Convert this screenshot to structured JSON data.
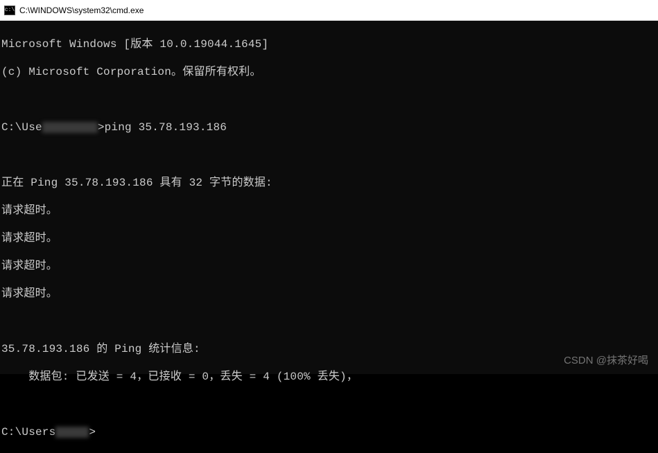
{
  "titlebar": {
    "path": "C:\\WINDOWS\\system32\\cmd.exe"
  },
  "terminal": {
    "banner_version": "Microsoft Windows [版本 10.0.19044.1645]",
    "banner_copyright": "(c) Microsoft Corporation。保留所有权利。",
    "prompt1_prefix": "C:\\Use",
    "prompt1_command": ">ping 35.78.193.186",
    "ping_header": "正在 Ping 35.78.193.186 具有 32 字节的数据:",
    "timeout1": "请求超时。",
    "timeout2": "请求超时。",
    "timeout3": "请求超时。",
    "timeout4": "请求超时。",
    "stats_header": "35.78.193.186 的 Ping 统计信息:",
    "stats_packets": "    数据包: 已发送 = 4，已接收 = 0，丢失 = 4 (100% 丢失)，",
    "prompt2_prefix": "C:\\Users",
    "prompt2_suffix": ">"
  },
  "watermark": {
    "text": "CSDN @抹茶好喝"
  }
}
